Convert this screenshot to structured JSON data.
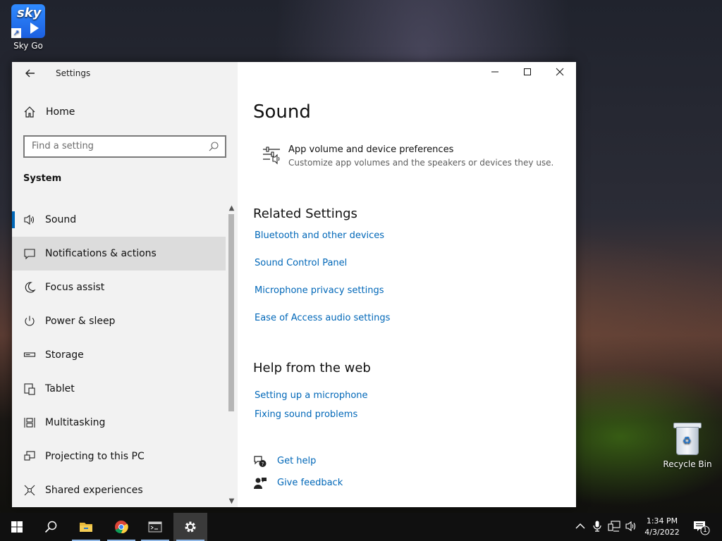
{
  "desktop": {
    "sky_go": {
      "tile_text": "sky",
      "label": "Sky Go"
    },
    "recycle_bin": {
      "label": "Recycle Bin"
    }
  },
  "window": {
    "app_title": "Settings",
    "controls": {
      "minimize": "─",
      "maximize": "☐",
      "close": "✕"
    }
  },
  "sidebar": {
    "home_label": "Home",
    "search_placeholder": "Find a setting",
    "section": "System",
    "items": [
      {
        "label": "Sound",
        "icon": "speaker-icon",
        "selected": true
      },
      {
        "label": "Notifications & actions",
        "icon": "notification-icon"
      },
      {
        "label": "Focus assist",
        "icon": "moon-icon"
      },
      {
        "label": "Power & sleep",
        "icon": "power-icon"
      },
      {
        "label": "Storage",
        "icon": "storage-icon"
      },
      {
        "label": "Tablet",
        "icon": "tablet-icon"
      },
      {
        "label": "Multitasking",
        "icon": "multitasking-icon"
      },
      {
        "label": "Projecting to this PC",
        "icon": "projecting-icon"
      },
      {
        "label": "Shared experiences",
        "icon": "shared-experiences-icon"
      }
    ]
  },
  "content": {
    "title": "Sound",
    "pref": {
      "title": "App volume and device preferences",
      "desc": "Customize app volumes and the speakers or devices they use."
    },
    "related_heading": "Related Settings",
    "related_links": [
      "Bluetooth and other devices",
      "Sound Control Panel",
      "Microphone privacy settings",
      "Ease of Access audio settings"
    ],
    "help_heading": "Help from the web",
    "help_links": [
      "Setting up a microphone",
      "Fixing sound problems"
    ],
    "get_help": "Get help",
    "give_feedback": "Give feedback"
  },
  "taskbar": {
    "time": "1:34 PM",
    "date": "4/3/2022",
    "notification_count": "1"
  },
  "colors": {
    "accent": "#0067b8",
    "sidebar_bg": "#f2f2f2",
    "taskbar_bg": "#101010"
  }
}
